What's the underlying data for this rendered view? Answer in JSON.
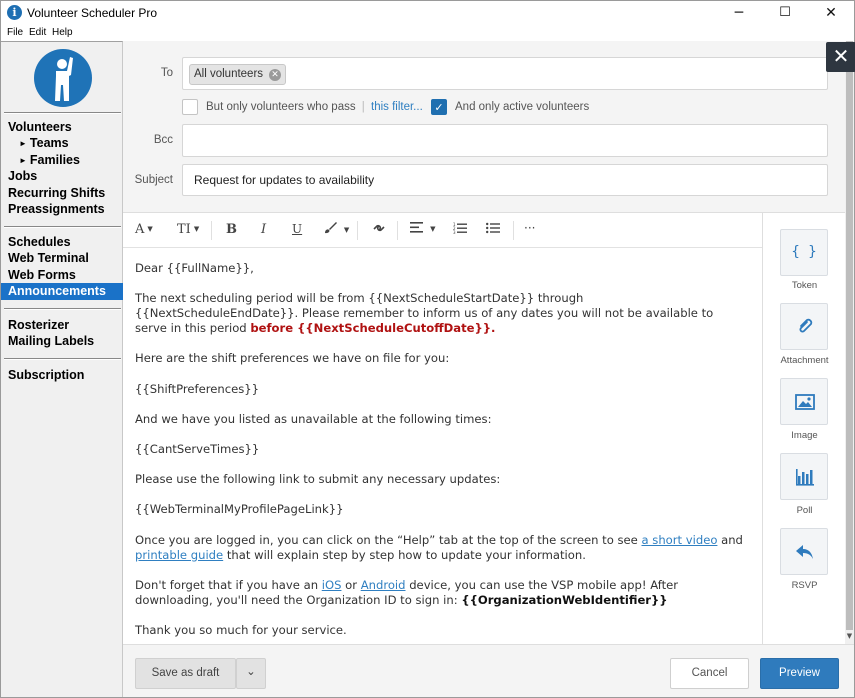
{
  "window": {
    "title": "Volunteer Scheduler Pro",
    "minimize": "─",
    "maximize": "☐",
    "close": "✕"
  },
  "menu": [
    "File",
    "Edit",
    "Help"
  ],
  "sidebar": {
    "items": [
      {
        "label": "Volunteers"
      },
      {
        "label": "Teams"
      },
      {
        "label": "Families"
      },
      {
        "label": "Jobs"
      },
      {
        "label": "Recurring Shifts"
      },
      {
        "label": "Preassignments"
      },
      {
        "label": "Schedules"
      },
      {
        "label": "Web Terminal"
      },
      {
        "label": "Web Forms"
      },
      {
        "label": "Announcements"
      },
      {
        "label": "Rosterizer"
      },
      {
        "label": "Mailing Labels"
      },
      {
        "label": "Subscription"
      }
    ]
  },
  "compose": {
    "to_label": "To",
    "to_chip": "All volunteers",
    "filter_text": "But only volunteers who pass",
    "filter_link": "this filter...",
    "active_text": "And only active volunteers",
    "active_checked": true,
    "bcc_label": "Bcc",
    "subject_label": "Subject",
    "subject_value": "Request for updates to availability"
  },
  "body": {
    "greeting": "Dear {{FullName}},",
    "p1_a": "The next scheduling period will be from {{NextScheduleStartDate}} through {{NextScheduleEndDate}}. Please remember to inform us of any dates you will not be available to serve in this period ",
    "p1_red": "before {{NextScheduleCutoffDate}}",
    "p1_end": ".",
    "p2": "Here are the shift preferences we have on file for you:",
    "p3": "{{ShiftPreferences}}",
    "p4": "And we have you listed as unavailable at the following times:",
    "p5": "{{CantServeTimes}}",
    "p6": "Please use the following link to submit any necessary updates:",
    "p7": "{{WebTerminalMyProfilePageLink}}",
    "p8_a": "Once you are logged in, you can click on the “Help” tab at the top of the screen to see ",
    "p8_link1": "a short video",
    "p8_b": " and ",
    "p8_link2": "printable guide",
    "p8_c": " that will explain step by step how to update your information.",
    "p9_a": "Don't forget that if you have an ",
    "p9_link1": "iOS",
    "p9_b": " or ",
    "p9_link2": "Android",
    "p9_c": " device, you can use the VSP mobile app! After downloading, you'll need the Organization ID to sign in: ",
    "p9_bold": "{{OrganizationWebIdentifier}}",
    "p10": "Thank you so much for your service."
  },
  "toolbar": {
    "font": "A",
    "size": "TI",
    "bold": "B",
    "italic": "I",
    "underline": "U",
    "brush": "🖌",
    "link": "🔗",
    "align": "≡",
    "ol": "⒈",
    "ul": "☰",
    "more": "···"
  },
  "side_tools": [
    {
      "label": "Token",
      "glyph": "{ }"
    },
    {
      "label": "Attachment",
      "glyph": "📎"
    },
    {
      "label": "Image",
      "glyph": "🖼"
    },
    {
      "label": "Poll",
      "glyph": "📊"
    },
    {
      "label": "RSVP",
      "glyph": "↩"
    }
  ],
  "footer": {
    "save_draft": "Save as draft",
    "dropdown": "⌄",
    "cancel": "Cancel",
    "preview": "Preview"
  }
}
